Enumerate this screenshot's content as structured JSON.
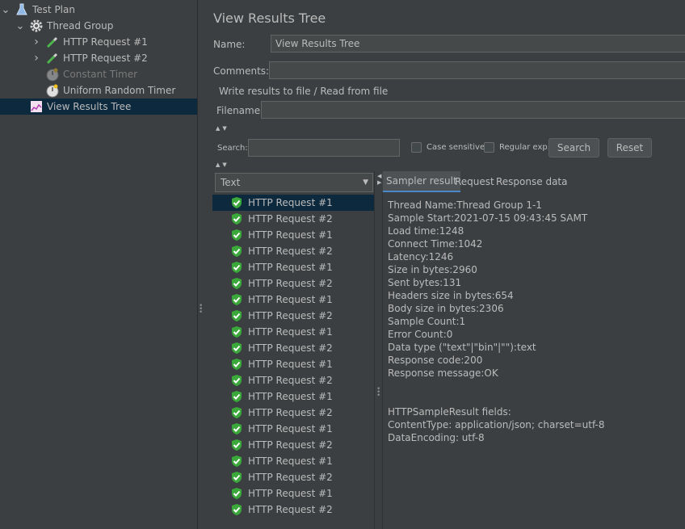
{
  "tree": [
    {
      "label": "Test Plan",
      "icon": "flask-icon",
      "chevron": "down",
      "indent": 0,
      "disabled": false,
      "selected": false
    },
    {
      "label": "Thread Group",
      "icon": "gear-icon",
      "chevron": "down",
      "indent": 1,
      "disabled": false,
      "selected": false
    },
    {
      "label": "HTTP Request #1",
      "icon": "pipette-icon",
      "chevron": "right",
      "indent": 2,
      "disabled": false,
      "selected": false
    },
    {
      "label": "HTTP Request #2",
      "icon": "pipette-icon",
      "chevron": "right",
      "indent": 2,
      "disabled": false,
      "selected": false
    },
    {
      "label": "Constant Timer",
      "icon": "timer-icon",
      "chevron": "",
      "indent": 2,
      "disabled": true,
      "selected": false
    },
    {
      "label": "Uniform Random Timer",
      "icon": "timer-icon",
      "chevron": "",
      "indent": 2,
      "disabled": false,
      "selected": false
    },
    {
      "label": "View Results Tree",
      "icon": "chart-icon",
      "chevron": "",
      "indent": 1,
      "disabled": false,
      "selected": true
    }
  ],
  "panel": {
    "title": "View Results Tree",
    "name_label": "Name:",
    "name_value": "View Results Tree",
    "comments_label": "Comments:",
    "comments_value": "",
    "file_group_label": "Write results to file / Read from file",
    "filename_label": "Filename",
    "filename_value": ""
  },
  "search": {
    "label": "Search:",
    "value": "",
    "case_sensitive_label": "Case sensitive",
    "regular_exp_label": "Regular exp.",
    "search_button": "Search",
    "reset_button": "Reset"
  },
  "renderer": {
    "selected": "Text"
  },
  "results": [
    "HTTP Request #1",
    "HTTP Request #2",
    "HTTP Request #1",
    "HTTP Request #2",
    "HTTP Request #1",
    "HTTP Request #2",
    "HTTP Request #1",
    "HTTP Request #2",
    "HTTP Request #1",
    "HTTP Request #2",
    "HTTP Request #1",
    "HTTP Request #2",
    "HTTP Request #1",
    "HTTP Request #2",
    "HTTP Request #1",
    "HTTP Request #2",
    "HTTP Request #1",
    "HTTP Request #2",
    "HTTP Request #1",
    "HTTP Request #2"
  ],
  "tabs": [
    "Sampler result",
    "Request",
    "Response data"
  ],
  "sampler_lines": [
    "Thread Name:Thread Group 1-1",
    "Sample Start:2021-07-15 09:43:45 SAMT",
    "Load time:1248",
    "Connect Time:1042",
    "Latency:1246",
    "Size in bytes:2960",
    "Sent bytes:131",
    "Headers size in bytes:654",
    "Body size in bytes:2306",
    "Sample Count:1",
    "Error Count:0",
    "Data type (\"text\"|\"bin\"|\"\"):text",
    "Response code:200",
    "Response message:OK",
    "",
    "",
    "HTTPSampleResult fields:",
    "ContentType: application/json; charset=utf-8",
    "DataEncoding: utf-8"
  ],
  "colors": {
    "background": "#3c3f41",
    "selection": "#0d293e",
    "success_green": "#4bb84b",
    "text": "#bbbbbb"
  }
}
